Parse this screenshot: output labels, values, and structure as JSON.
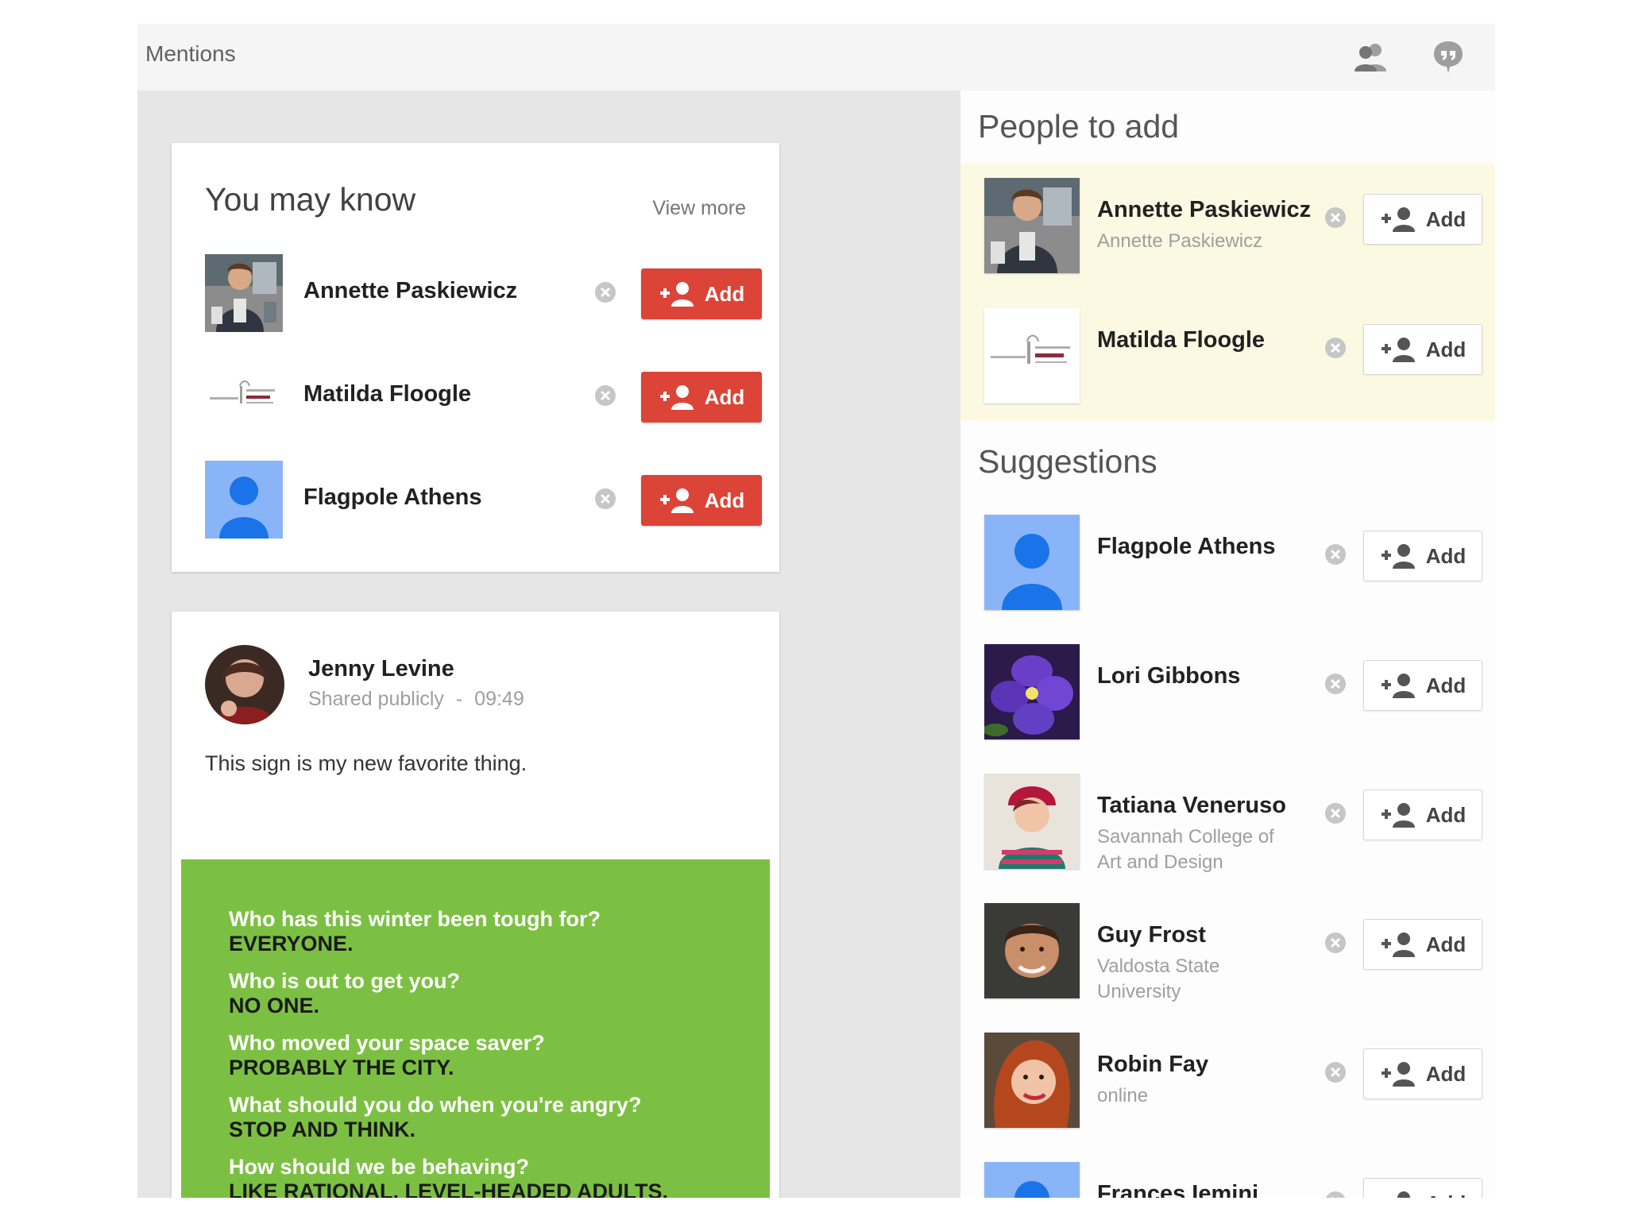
{
  "topbar": {
    "title": "Mentions",
    "icons": [
      "people-icon",
      "feedback-icon"
    ]
  },
  "you_may_know": {
    "heading": "You may know",
    "view_more": "View more",
    "add_label": "Add",
    "people": [
      {
        "name": "Annette Paskiewicz",
        "avatar": "photo"
      },
      {
        "name": "Matilda Floogle",
        "avatar": "logo"
      },
      {
        "name": "Flagpole Athens",
        "avatar": "default-profile"
      }
    ]
  },
  "post": {
    "author": "Jenny Levine",
    "visibility": "Shared publicly",
    "separator": "-",
    "time": "09:49",
    "text": "This sign is my new favorite thing.",
    "image_lines": [
      {
        "q": "Who has this winter been tough for?",
        "a": "EVERYONE."
      },
      {
        "q": "Who is out to get you?",
        "a": "NO ONE."
      },
      {
        "q": "Who moved your space saver?",
        "a": "PROBABLY THE CITY."
      },
      {
        "q": "What should you do when you're angry?",
        "a": "STOP AND THINK."
      },
      {
        "q": "How should we be behaving?",
        "a": "LIKE RATIONAL, LEVEL-HEADED ADULTS."
      }
    ],
    "image_color": "#7cc043"
  },
  "people_to_add": {
    "heading": "People to add",
    "add_label": "Add",
    "people": [
      {
        "name": "Annette Paskiewicz",
        "sub": "Annette Paskiewicz"
      },
      {
        "name": "Matilda Floogle",
        "sub": ""
      }
    ]
  },
  "suggestions": {
    "heading": "Suggestions",
    "add_label": "Add",
    "people": [
      {
        "name": "Flagpole Athens",
        "sub": ""
      },
      {
        "name": "Lori Gibbons",
        "sub": ""
      },
      {
        "name": "Tatiana Veneruso",
        "sub": "Savannah College of Art and Design"
      },
      {
        "name": "Guy Frost",
        "sub": "Valdosta State University"
      },
      {
        "name": "Robin Fay",
        "sub": "online"
      },
      {
        "name": "Frances Iemini",
        "sub": ""
      }
    ]
  },
  "colors": {
    "primary_add": "#db4437",
    "highlight": "#fcf9e3",
    "default_avatar": "#8ab4f8",
    "default_avatar_figure": "#1a73e8"
  }
}
